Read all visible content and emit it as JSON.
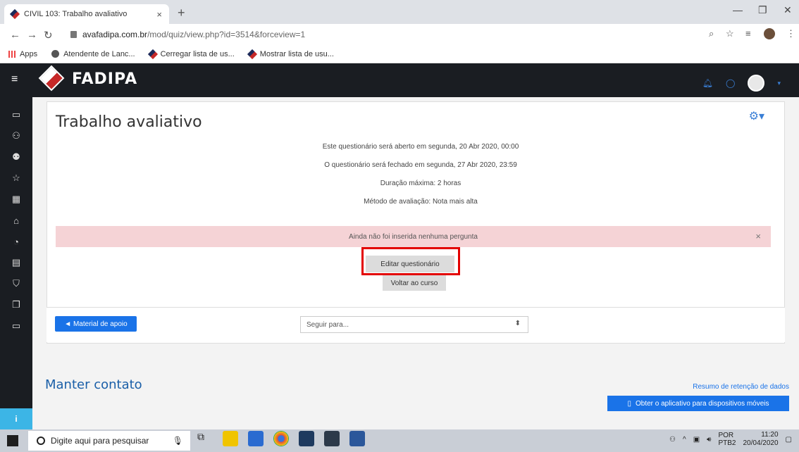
{
  "browser": {
    "tab_title": "CIVIL 103: Trabalho avaliativo",
    "tab_close": "×",
    "new_tab": "+",
    "url_host": "avafadipa.com.br",
    "url_path": "/mod/quiz/view.php?id=3514&forceview=1",
    "bookmarks": [
      {
        "label": "Apps"
      },
      {
        "label": "Atendente de Lanc..."
      },
      {
        "label": "Cerregar lista de us..."
      },
      {
        "label": "Mostrar lista de usu..."
      }
    ]
  },
  "site": {
    "logo_text": "FADIPA"
  },
  "page": {
    "title": "Trabalho avaliativo",
    "open_info": "Este questionário será aberto em segunda, 20 Abr 2020, 00:00",
    "close_info": "O questionário será fechado em segunda, 27 Abr 2020, 23:59",
    "duration": "Duração máxima: 2 horas",
    "grading": "Método de avaliação: Nota mais alta",
    "alert": "Ainda não foi inserida nenhuma pergunta",
    "edit_button": "Editar questionário",
    "back_button": "Voltar ao curso",
    "prev_button": "◄ Material de apoio",
    "jump_placeholder": "Seguir para..."
  },
  "footer": {
    "title": "Manter contato",
    "retention_link": "Resumo de retenção de dados",
    "app_button": "Obter o aplicativo para dispositivos móveis"
  },
  "taskbar": {
    "search_placeholder": "Digite aqui para pesquisar",
    "lang": "POR",
    "lang2": "PTB2",
    "time": "11:20",
    "date": "20/04/2020"
  },
  "colors": {
    "accent": "#1a73e8",
    "topbar": "#1a1d22",
    "alert_bg": "#f5d3d6",
    "highlight": "#e30000"
  }
}
